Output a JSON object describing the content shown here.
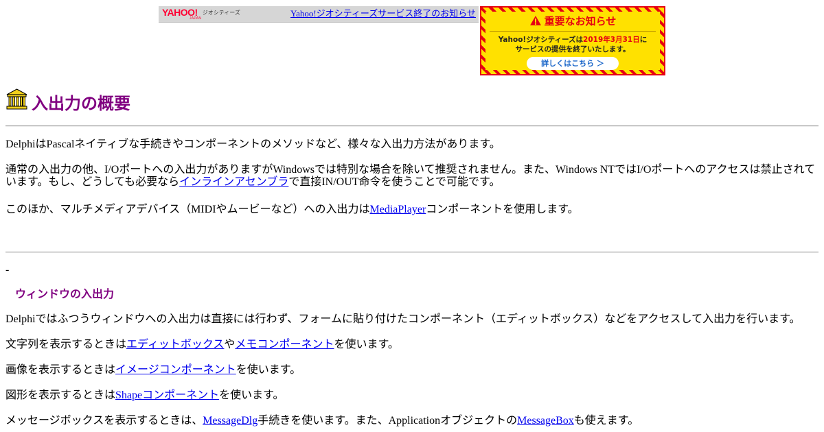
{
  "banner": {
    "logo_text": "YAHOO!",
    "logo_sub": "JAPAN",
    "logo_service": "ジオシティーズ",
    "link_text": "Yahoo!ジオシティーズサービス終了のお知らせ"
  },
  "notice": {
    "heading": "重要なお知らせ",
    "line1_pre": "Yahoo!ジオシティーズは",
    "line1_date": "2019年3月31日",
    "line1_post": "に",
    "line2": "サービスの提供を終了いたします。",
    "button": "詳しくはこちら ＞",
    "colors": {
      "accent": "#e60012",
      "background": "#ffe100"
    }
  },
  "page": {
    "title": "入出力の概要",
    "icon": "bank-building-icon",
    "title_color": "#800080"
  },
  "intro": {
    "p1": "DelphiはPascalネイティブな手続きやコンポーネントのメソッドなど、様々な入出力方法があります。",
    "p2_pre": "通常の入出力の他、I/Oポートへの入出力がありますがWindowsでは特別な場合を除いて推奨されません。また、Windows NTではI/Oポートへのアクセスは禁止されています。もし、どうしても必要なら",
    "p2_link": "インラインアセンブラ",
    "p2_post": "で直接IN/OUT命令を使うことで可能です。",
    "p3_pre": "このほか、マルチメディアデバイス（MIDIやムービーなど）への入出力は",
    "p3_link": "MediaPlayer",
    "p3_post": "コンポーネントを使用します。"
  },
  "section": {
    "dash": "-",
    "title": "ウィンドウの入出力",
    "p1": "Delphiではふつうウィンドウへの入出力は直接には行わず、フォームに貼り付けたコンポーネント（エディットボックス）などをアクセスして入出力を行います。",
    "p2_pre": "文字列を表示するときは",
    "p2_link1": "エディットボックス",
    "p2_mid": "や",
    "p2_link2": "メモコンポーネント",
    "p2_post": "を使います。",
    "p3_pre": "画像を表示するときは",
    "p3_link": "イメージコンポーネント",
    "p3_post": "を使います。",
    "p4_pre": "図形を表示するときは",
    "p4_link": "Shapeコンポーネント",
    "p4_post": "を使います。",
    "p5_pre": "メッセージボックスを表示するときは、",
    "p5_link1": "MessageDlg",
    "p5_mid": "手続きを使います。また、Applicationオブジェクトの",
    "p5_link2": "MessageBox",
    "p5_post": "も使えます。"
  }
}
